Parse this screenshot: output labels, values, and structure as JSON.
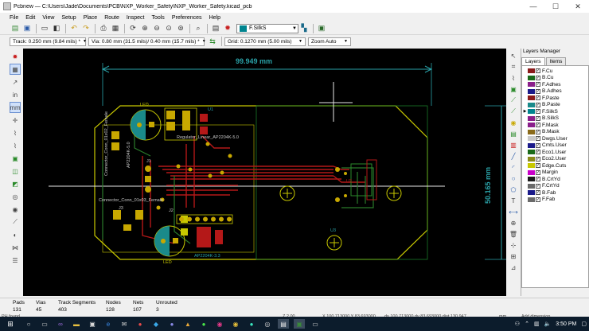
{
  "window": {
    "title": "Pcbnew — C:\\Users\\Jade\\Documents\\PCB\\NXP_Worker_Safety\\NXP_Worker_Safety.kicad_pcb"
  },
  "menu": [
    "File",
    "Edit",
    "View",
    "Setup",
    "Place",
    "Route",
    "Inspect",
    "Tools",
    "Preferences",
    "Help"
  ],
  "toolbar": {
    "active_layer": "F.SilkS",
    "active_layer_color": "#00848f"
  },
  "toolbar2": {
    "track": "Track: 0.250 mm (9.84 mils) *",
    "via": "Via: 0.80 mm (31.5 mils)/ 0.40 mm (15.7 mils) *",
    "grid": "Grid: 0.1270 mm (5.00 mils)",
    "zoom": "Zoom Auto"
  },
  "board": {
    "width_dim": "99.949 mm",
    "height_dim": "50.165 mm",
    "labels": {
      "u1": "U1",
      "u2": "U2",
      "u3": "U3",
      "j1": "J1",
      "j2": "J2",
      "j3": "J3",
      "reg1": "AP2204K-5.0",
      "reg2": "AP2204K-3.3",
      "regulator_label": "Regulator_Linear_AP2204K-5.0",
      "conn": "Connector_Conn_01x02_Female",
      "conn2": "Connector_Conn_01x03_Female",
      "led1": "LED",
      "led2": "LED"
    }
  },
  "layers_manager": {
    "title": "Layers Manager",
    "tabs": [
      "Layers",
      "Items"
    ],
    "active_tab": 0,
    "current": "F.SilkS",
    "layers": [
      {
        "name": "F.Cu",
        "color": "#8b1a1a"
      },
      {
        "name": "B.Cu",
        "color": "#1a6a1a"
      },
      {
        "name": "F.Adhes",
        "color": "#8a1e8a"
      },
      {
        "name": "B.Adhes",
        "color": "#1a1a8a"
      },
      {
        "name": "F.Paste",
        "color": "#8b1a1a"
      },
      {
        "name": "B.Paste",
        "color": "#1a8a8a"
      },
      {
        "name": "F.SilkS",
        "color": "#00848f"
      },
      {
        "name": "B.SilkS",
        "color": "#8a1e8a"
      },
      {
        "name": "F.Mask",
        "color": "#8a1e8a"
      },
      {
        "name": "B.Mask",
        "color": "#8a6a1a"
      },
      {
        "name": "Dwgs.User",
        "color": "#c8c8c8"
      },
      {
        "name": "Cmts.User",
        "color": "#1a1a8a"
      },
      {
        "name": "Eco1.User",
        "color": "#1a6a1a"
      },
      {
        "name": "Eco2.User",
        "color": "#8a8a1a"
      },
      {
        "name": "Edge.Cuts",
        "color": "#c8c800"
      },
      {
        "name": "Margin",
        "color": "#c800c8"
      },
      {
        "name": "B.CrtYd",
        "color": "#1a1a1a"
      },
      {
        "name": "F.CrtYd",
        "color": "#6a6a6a"
      },
      {
        "name": "B.Fab",
        "color": "#1a1a8a"
      },
      {
        "name": "F.Fab",
        "color": "#6a6a6a"
      }
    ]
  },
  "status": {
    "items": [
      {
        "label": "Pads",
        "value": "131"
      },
      {
        "label": "Vias",
        "value": "45"
      },
      {
        "label": "Track Segments",
        "value": "403"
      },
      {
        "label": "Nodes",
        "value": "128"
      },
      {
        "label": "Nets",
        "value": "107"
      },
      {
        "label": "Unrouted",
        "value": "3"
      }
    ],
    "z": "Z 2.00",
    "xy": "X 100.713000  Y 83.693000",
    "dxy": "dx 100.713000  dy 83.693000  dist 130.947",
    "unit": "mm",
    "mode": "Add dimension",
    "found": "PH found"
  },
  "taskbar": {
    "time": "3:50 PM"
  }
}
